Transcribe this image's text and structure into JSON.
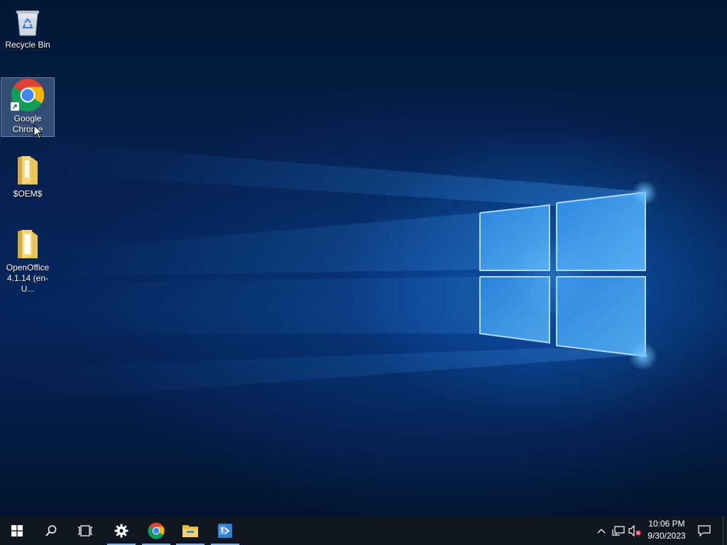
{
  "desktop": {
    "icons": [
      {
        "label": "Recycle Bin",
        "icon": "recycle-bin-icon"
      },
      {
        "label": "Google Chrome",
        "icon": "chrome-icon",
        "selected": true
      },
      {
        "label": "$OEM$",
        "icon": "folder-icon"
      },
      {
        "label": "OpenOffice 4.1.14 (en-U...",
        "icon": "folder-icon"
      }
    ]
  },
  "taskbar": {
    "start": "windows-start-icon",
    "pinned": [
      "search-icon",
      "task-view-icon",
      "settings-icon",
      "chrome-icon",
      "file-explorer-icon",
      "remote-desktop-icon"
    ],
    "accent": "#7eb4ea",
    "background": "#101722"
  },
  "tray": {
    "icons": [
      "chevron-up-icon",
      "network-icon",
      "volume-muted-icon"
    ],
    "time": "10:06 PM",
    "date": "9/30/2023",
    "notification": "action-center-icon"
  }
}
